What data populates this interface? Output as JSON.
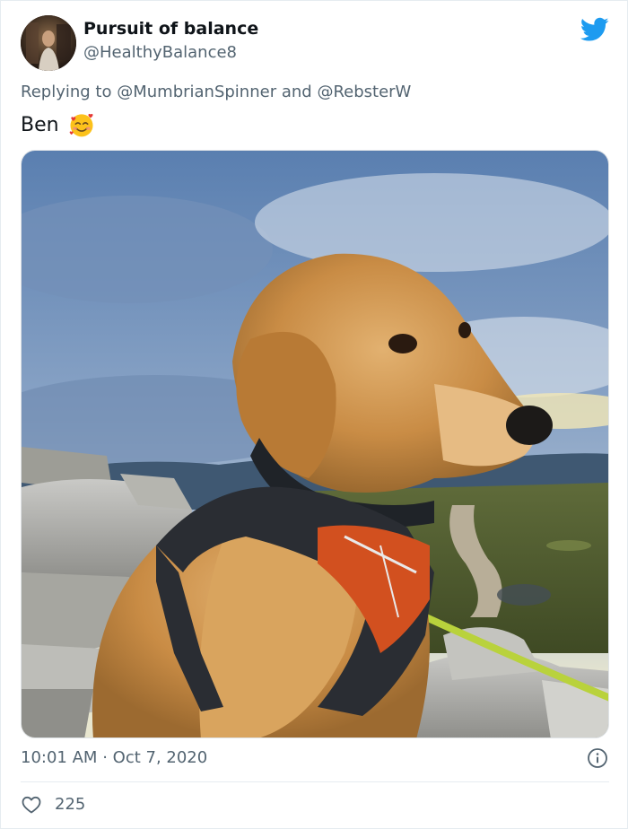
{
  "author": {
    "display_name": "Pursuit of balance",
    "handle": "@HealthyBalance8"
  },
  "reply": {
    "prefix": "Replying to",
    "mention_1": "@MumbrianSpinner",
    "joiner": "and",
    "mention_2": "@RebsterW"
  },
  "tweet": {
    "text": "Ben",
    "emoji": "smiling-face-with-hearts"
  },
  "photo": {
    "subject": "golden-retriever-puppy-in-orange-harness"
  },
  "meta": {
    "time": "10:01 AM",
    "separator": "·",
    "date": "Oct 7, 2020"
  },
  "stats": {
    "likes": "225"
  },
  "colors": {
    "brand_blue": "#1d9bf0",
    "muted_text": "#536471",
    "main_text": "#0f1419"
  },
  "icons": {
    "logo": "twitter-bird-icon",
    "info": "info-icon",
    "like": "heart-outline-icon"
  }
}
